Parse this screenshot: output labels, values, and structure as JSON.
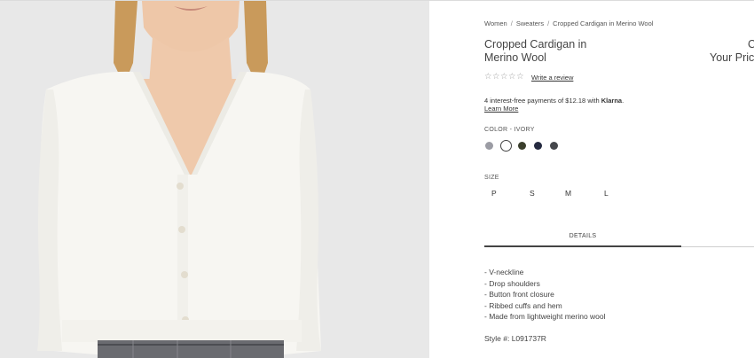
{
  "breadcrumb": {
    "items": [
      "Women",
      "Sweaters",
      "Cropped Cardigan in Merino Wool"
    ],
    "separator": "/"
  },
  "product": {
    "title": "Cropped Cardigan in Merino Wool",
    "price_fragment": {
      "line1": "C",
      "line2": "Your Pric"
    },
    "rating": {
      "stars": "☆☆☆☆☆",
      "write_review": "Write a review"
    },
    "klarna": {
      "prefix": "4 interest-free payments of $12.18 with ",
      "brand": "Klarna",
      "suffix": ".",
      "learn_more": "Learn More"
    },
    "color": {
      "label": "COLOR -  IVORY",
      "swatches": [
        {
          "name": "gray",
          "hex": "#9b9ca4"
        },
        {
          "name": "ivory",
          "hex": "#ffffff",
          "selected": true
        },
        {
          "name": "olive",
          "hex": "#3b3f2c"
        },
        {
          "name": "navy",
          "hex": "#252a40"
        },
        {
          "name": "charcoal",
          "hex": "#45474c"
        }
      ]
    },
    "size": {
      "label": "SIZE",
      "options": [
        "P",
        "S",
        "M",
        "L"
      ]
    },
    "tabs": {
      "details": "DETAILS"
    },
    "details": [
      "- V-neckline",
      "- Drop shoulders",
      "- Button front closure",
      "- Ribbed cuffs and hem",
      "- Made from lightweight merino wool"
    ],
    "style_number": "Style #: L091737R"
  }
}
